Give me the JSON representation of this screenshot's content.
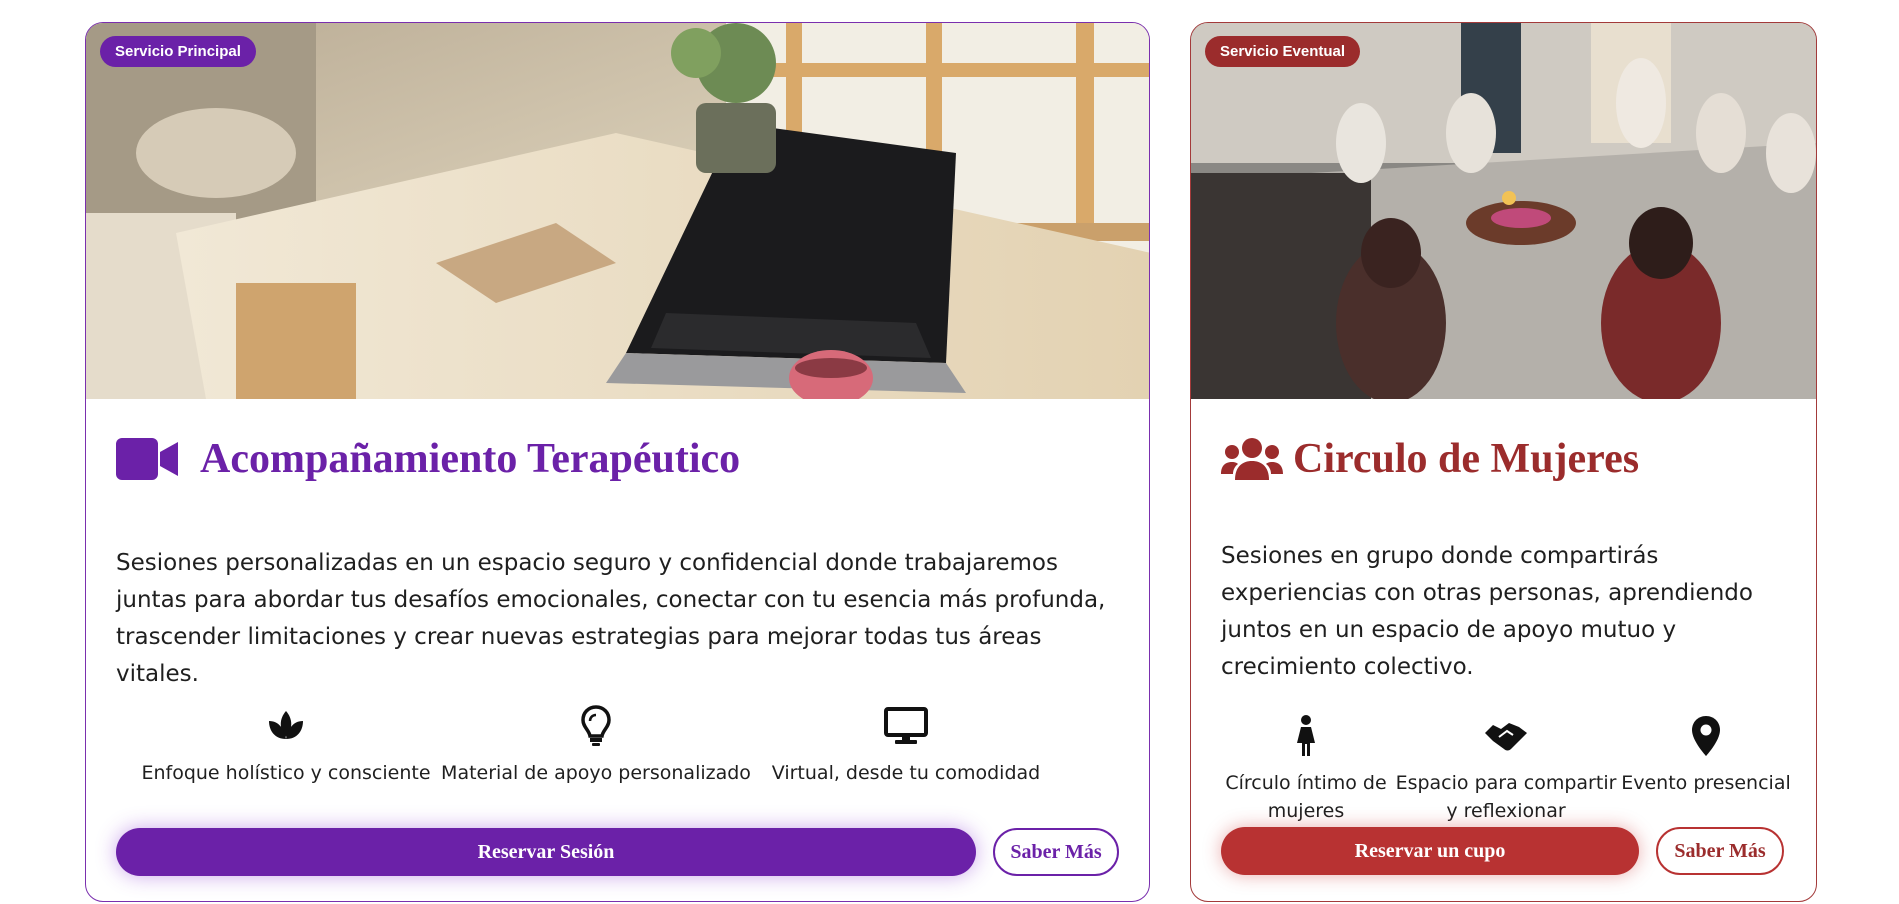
{
  "colors": {
    "primary_purple": "#6b21a8",
    "event_red": "#9b2c2c",
    "cta_red": "#b83232",
    "text": "#1f1f1f"
  },
  "cards": [
    {
      "badge": "Servicio Principal",
      "title_icon": "video-camera-icon",
      "title": "Acompañamiento Terapéutico",
      "description": "Sesiones personalizadas en un espacio seguro y confidencial donde trabajaremos juntas para abordar tus desafíos emocionales, conectar con tu esencia más profunda, trascender limitaciones y crear nuevas estrategias para mejorar todas tus áreas vitales.",
      "features": [
        {
          "icon": "lotus-icon",
          "label": "Enfoque holístico y consciente"
        },
        {
          "icon": "lightbulb-icon",
          "label": "Material de apoyo personalizado"
        },
        {
          "icon": "monitor-icon",
          "label": "Virtual, desde tu comodidad"
        }
      ],
      "cta_label": "Reservar Sesión",
      "more_label": "Saber Más"
    },
    {
      "badge": "Servicio Eventual",
      "title_icon": "users-icon",
      "title": "Circulo de Mujeres",
      "description": "Sesiones en grupo donde compartirás experiencias con otras personas, aprendiendo juntos en un espacio de apoyo mutuo y crecimiento colectivo.",
      "features": [
        {
          "icon": "female-icon",
          "label": "Círculo íntimo de mujeres"
        },
        {
          "icon": "handshake-icon",
          "label": "Espacio para compartir y reflexionar"
        },
        {
          "icon": "map-pin-icon",
          "label": "Evento presencial"
        }
      ],
      "cta_label": "Reservar un cupo",
      "more_label": "Saber Más"
    }
  ]
}
